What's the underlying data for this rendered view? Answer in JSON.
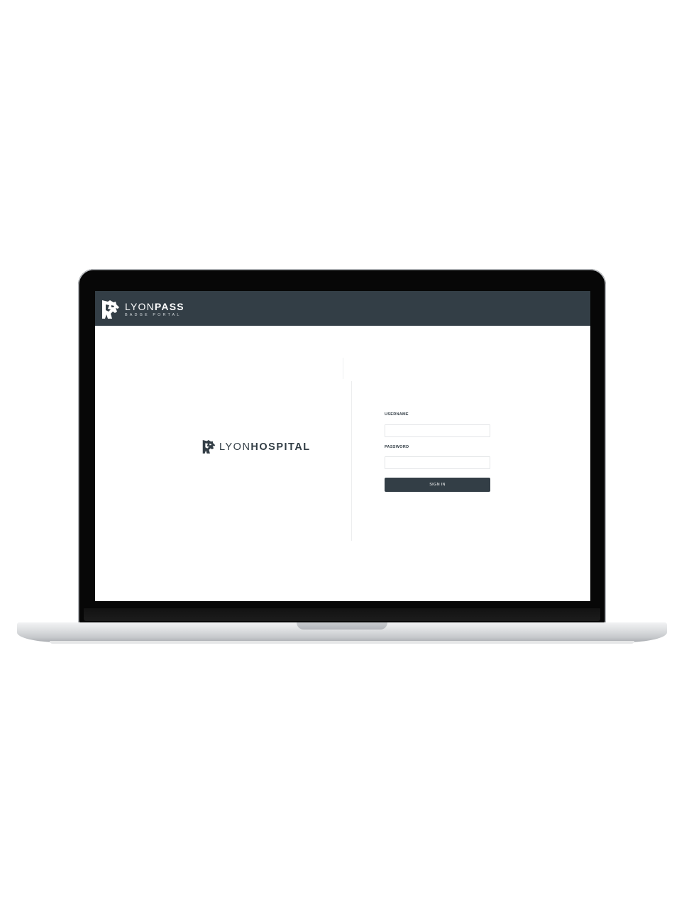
{
  "header": {
    "brand_light": "LYON",
    "brand_bold": "PASS",
    "brand_subtitle": "BADGE PORTAL",
    "background_color": "#333e46"
  },
  "left_panel": {
    "logo_light": "LYON",
    "logo_bold": "HOSPITAL",
    "logo_icon": "lion-head-icon"
  },
  "login": {
    "username_label": "USERNAME",
    "username_value": "",
    "password_label": "PASSWORD",
    "password_value": "",
    "signin_label": "SIGN IN"
  },
  "colors": {
    "primary": "#333e46",
    "screen_background": "#ffffff"
  }
}
